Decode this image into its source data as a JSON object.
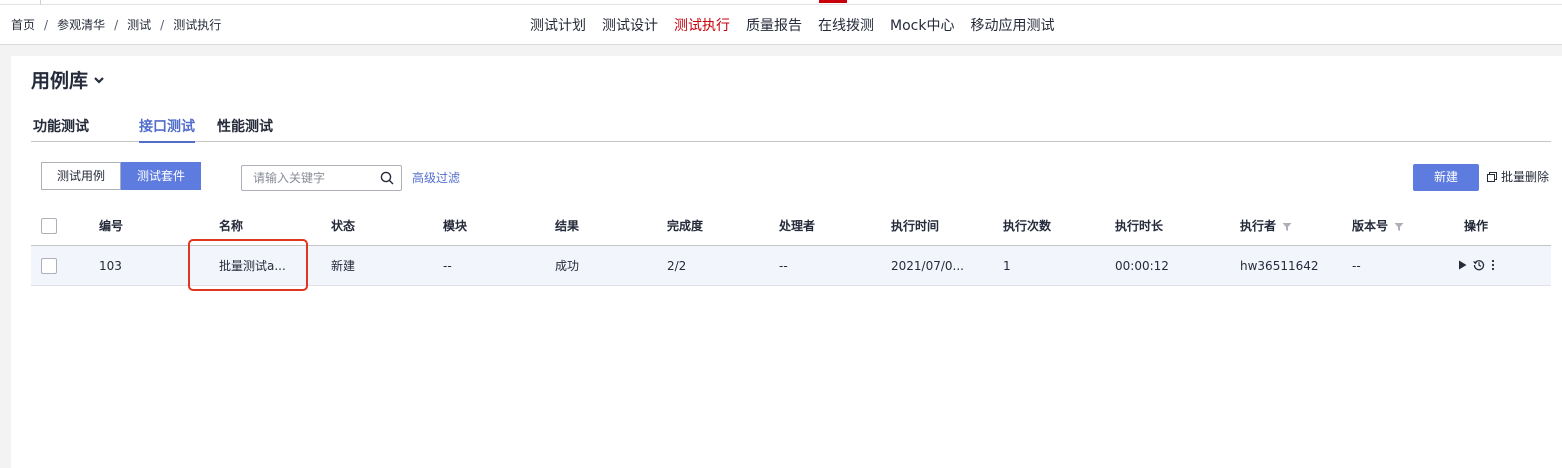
{
  "breadcrumb": [
    "首页",
    "参观清华",
    "测试",
    "测试执行"
  ],
  "breadcrumb_separator": "/",
  "top_nav": [
    {
      "label": "测试计划",
      "active": false
    },
    {
      "label": "测试设计",
      "active": false
    },
    {
      "label": "测试执行",
      "active": true
    },
    {
      "label": "质量报告",
      "active": false
    },
    {
      "label": "在线拨测",
      "active": false
    },
    {
      "label": "Mock中心",
      "active": false
    },
    {
      "label": "移动应用测试",
      "active": false
    }
  ],
  "page_title": "用例库",
  "tabs": [
    {
      "label": "功能测试",
      "active": false
    },
    {
      "label": "接口测试",
      "active": true
    },
    {
      "label": "性能测试",
      "active": false
    }
  ],
  "segment": [
    {
      "label": "测试用例",
      "active": false
    },
    {
      "label": "测试套件",
      "active": true
    }
  ],
  "search": {
    "placeholder": "请输入关键字",
    "value": ""
  },
  "advanced_filter": "高级过滤",
  "new_button": "新建",
  "bulk_delete": "批量删除",
  "table": {
    "columns": [
      "编号",
      "名称",
      "状态",
      "模块",
      "结果",
      "完成度",
      "处理者",
      "执行时间",
      "执行次数",
      "执行时长",
      "执行者",
      "版本号",
      "操作"
    ],
    "rows": [
      [
        "103",
        "批量测试a...",
        "新建",
        "--",
        "成功",
        "2/2",
        "--",
        "2021/07/0...",
        "1",
        "00:00:12",
        "hw36511642",
        "--"
      ]
    ]
  },
  "colors": {
    "accent": "#5e7ce0",
    "link": "#526ecc",
    "nav_active": "#c7000b",
    "highlight_box": "#e0361f"
  }
}
